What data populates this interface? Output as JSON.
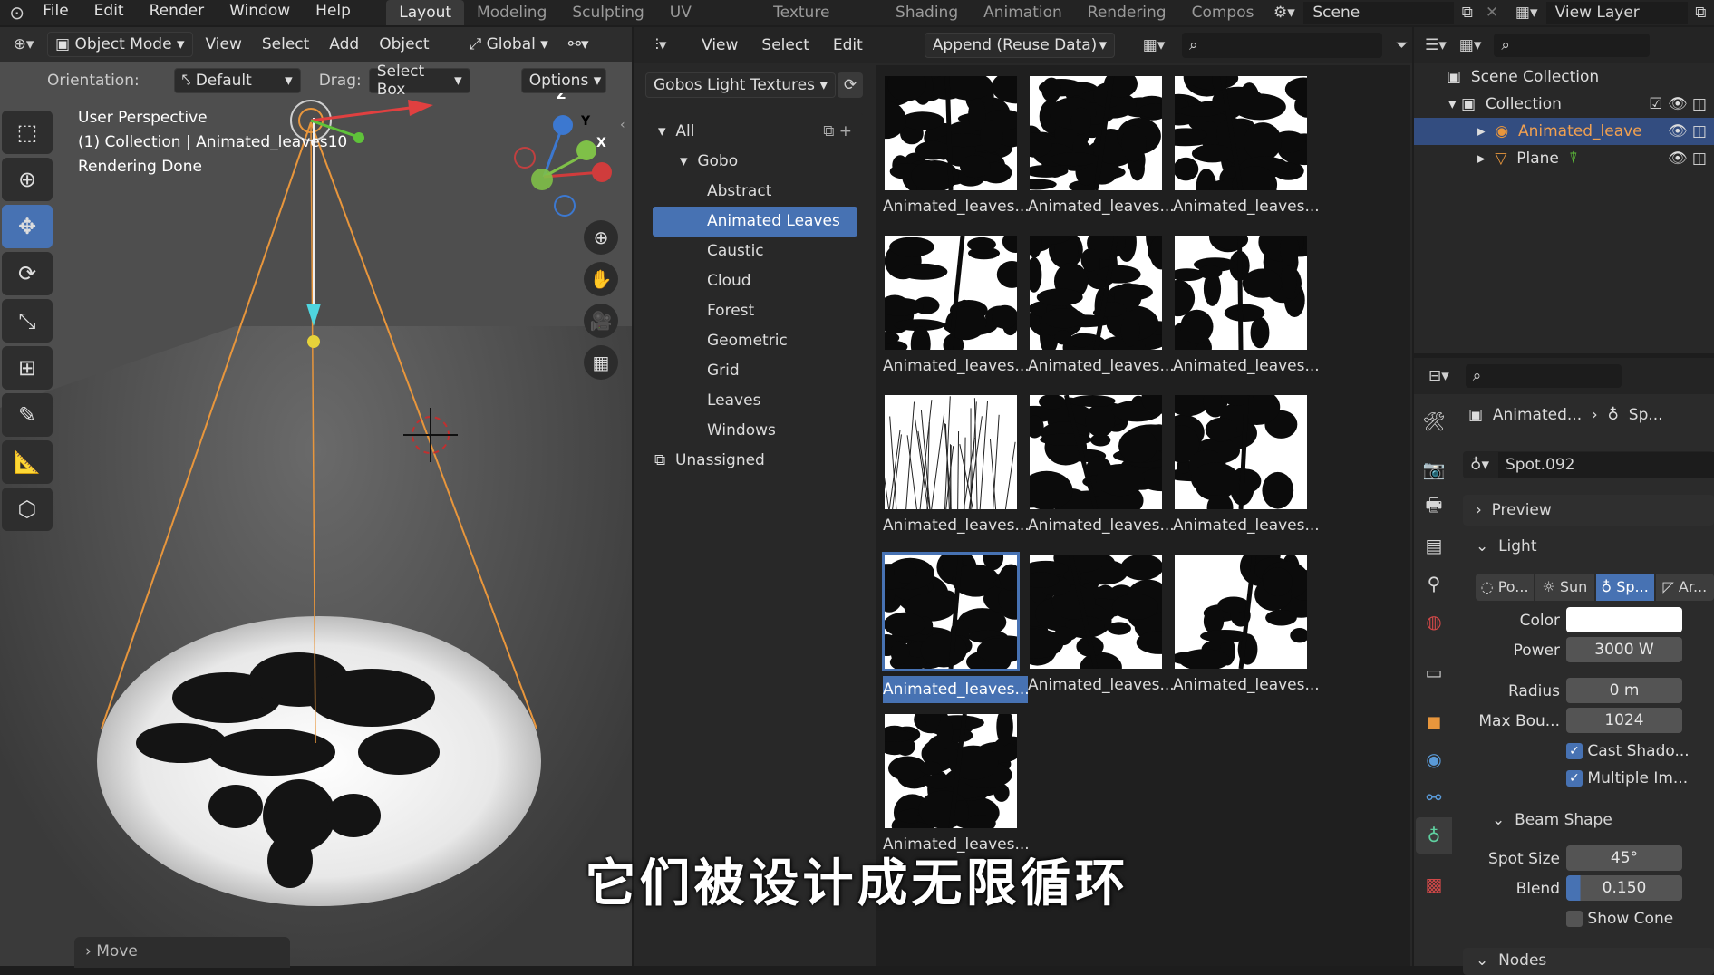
{
  "topbar": {
    "menus": [
      "File",
      "Edit",
      "Render",
      "Window",
      "Help"
    ],
    "workspaces": [
      "Layout",
      "Modeling",
      "Sculpting",
      "UV Editing",
      "Texture Paint",
      "Shading",
      "Animation",
      "Rendering",
      "Compos"
    ],
    "active_workspace": "Layout",
    "scene": "Scene",
    "view_layer": "View Layer"
  },
  "viewport": {
    "mode": "Object Mode",
    "menus": [
      "View",
      "Select",
      "Add",
      "Object"
    ],
    "transform": "Global",
    "orientation_label": "Orientation:",
    "orientation": "Default",
    "drag_label": "Drag:",
    "drag": "Select Box",
    "options": "Options",
    "info": [
      "User Perspective",
      "(1) Collection | Animated_leaves10",
      "Rendering Done"
    ],
    "axes": {
      "z": "Z",
      "y": "Y",
      "x": "X"
    },
    "move_panel": "Move"
  },
  "browser": {
    "menus": [
      "View",
      "Select",
      "Edit"
    ],
    "import_mode": "Append (Reuse Data)",
    "library": "Gobos Light Textures",
    "tree": [
      {
        "label": "All",
        "level": 0
      },
      {
        "label": "Gobo",
        "level": 1
      },
      {
        "label": "Abstract",
        "level": 2
      },
      {
        "label": "Animated Leaves",
        "level": 2,
        "selected": true
      },
      {
        "label": "Caustic",
        "level": 2
      },
      {
        "label": "Cloud",
        "level": 2
      },
      {
        "label": "Forest",
        "level": 2
      },
      {
        "label": "Geometric",
        "level": 2
      },
      {
        "label": "Grid",
        "level": 2
      },
      {
        "label": "Leaves",
        "level": 2
      },
      {
        "label": "Windows",
        "level": 2
      },
      {
        "label": "Unassigned",
        "level": 0
      }
    ],
    "assets": [
      "Animated_leaves...",
      "Animated_leaves...",
      "Animated_leaves...",
      "Animated_leaves...",
      "Animated_leaves...",
      "Animated_leaves...",
      "Animated_leaves...",
      "Animated_leaves...",
      "Animated_leaves...",
      "Animated_leaves...",
      "Animated_leaves...",
      "Animated_leaves...",
      "Animated_leaves..."
    ],
    "selected_asset": 9
  },
  "outliner": {
    "scene_collection": "Scene Collection",
    "collection": "Collection",
    "items": [
      "Animated_leave",
      "Plane"
    ]
  },
  "properties": {
    "breadcrumb": [
      "Animated...",
      "Sp..."
    ],
    "datablock": "Spot.092",
    "preview": "Preview",
    "light": "Light",
    "light_types": [
      "Po...",
      "Sun",
      "Sp...",
      "Ar..."
    ],
    "color_label": "Color",
    "power_label": "Power",
    "power": "3000 W",
    "radius_label": "Radius",
    "radius": "0 m",
    "maxb_label": "Max Bou...",
    "maxb": "1024",
    "cast_shadow": "Cast Shado...",
    "multiple": "Multiple Im...",
    "beam_shape": "Beam Shape",
    "spot_size_label": "Spot Size",
    "spot_size": "45°",
    "blend_label": "Blend",
    "blend": "0.150",
    "show_cone": "Show Cone",
    "nodes": "Nodes"
  },
  "subtitle": "它们被设计成无限循环",
  "colors": {
    "accent": "#4772b3",
    "spot_line": "#e8963c"
  }
}
